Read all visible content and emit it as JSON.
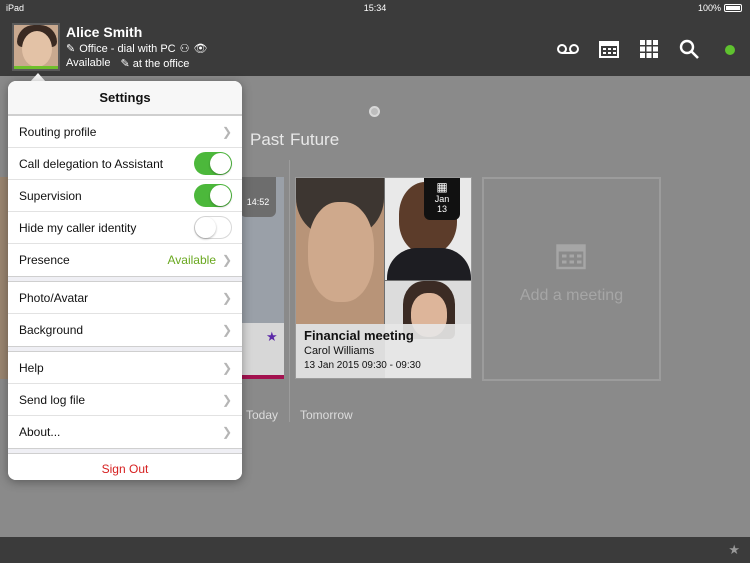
{
  "status_bar": {
    "device": "iPad",
    "time": "15:34",
    "battery": "100%"
  },
  "user": {
    "name": "Alice Smith",
    "routing": "Office - dial with PC",
    "presence": "Available",
    "location": "at the office"
  },
  "header_icons": [
    "voicemail-icon",
    "calendar-icon",
    "apps-grid-icon",
    "search-icon"
  ],
  "colors": {
    "header_bg": "#3b3b3b",
    "online": "#5fc22f",
    "toggle_on": "#4cb83b",
    "sign_out": "#d61f1f",
    "presence_value": "#6aa820"
  },
  "timeline": {
    "tabs": [
      "Past",
      "Future"
    ],
    "prev_card_time": "14:52",
    "day_labels": [
      "Today",
      "Tomorrow"
    ],
    "meeting": {
      "title": "Financial meeting",
      "person": "Carol Williams",
      "time": "13 Jan 2015 09:30 - 09:30",
      "badge_month": "Jan",
      "badge_day": "13"
    },
    "add_meeting": "Add a meeting"
  },
  "settings": {
    "title": "Settings",
    "group1": {
      "routing_profile": "Routing profile",
      "call_delegation": "Call delegation to Assistant",
      "call_delegation_on": true,
      "supervision": "Supervision",
      "supervision_on": true,
      "hide_caller": "Hide my caller identity",
      "hide_caller_on": false,
      "presence": "Presence",
      "presence_value": "Available"
    },
    "group2": {
      "photo": "Photo/Avatar",
      "background": "Background"
    },
    "group3": {
      "help": "Help",
      "send_log": "Send log file",
      "about": "About..."
    },
    "sign_out": "Sign Out"
  }
}
